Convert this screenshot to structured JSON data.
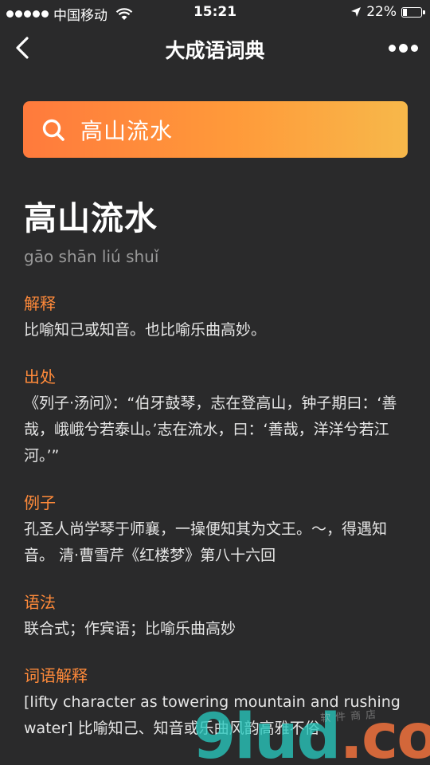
{
  "status_bar": {
    "carrier": "中国移动",
    "time": "15:21",
    "battery": "22%",
    "battery_level": 0.22
  },
  "nav": {
    "title": "大成语词典"
  },
  "search": {
    "value": "高山流水"
  },
  "idiom": {
    "title": "高山流水",
    "pinyin": "gāo shān liú shuǐ"
  },
  "sections": [
    {
      "heading": "解释",
      "body": "比喻知己或知音。也比喻乐曲高妙。"
    },
    {
      "heading": "出处",
      "body": "《列子·汤问》：“伯牙鼓琴，志在登高山，钟子期曰：‘善哉，峨峨兮若泰山。’志在流水，曰：‘善哉，洋洋兮若江河。’”"
    },
    {
      "heading": "例子",
      "body": "孔圣人尚学琴于师襄，一操便知其为文王。～，得遇知音。 清·曹雪芹《红楼梦》第八十六回"
    },
    {
      "heading": "语法",
      "body": "联合式；作宾语；比喻乐曲高妙"
    },
    {
      "heading": "词语解释",
      "body": "[lifty character as towering mountain and rushing water] 比喻知己、知音或乐曲风韵高雅不俗"
    }
  ],
  "watermark": {
    "main": "9lud",
    "suffix": ".com",
    "sub": "软件商店"
  },
  "colors": {
    "background": "#2a2a2b",
    "accent_orange": "#ff8a3a",
    "search_gradient_start": "#ff7a3c",
    "search_gradient_end": "#f7b84a",
    "pinyin_gray": "#9a9a9a"
  },
  "icons": {
    "back": "chevron-left-icon",
    "more": "more-dots-icon",
    "search": "search-icon",
    "wifi": "wifi-icon",
    "location": "location-arrow-icon",
    "battery": "battery-icon"
  }
}
